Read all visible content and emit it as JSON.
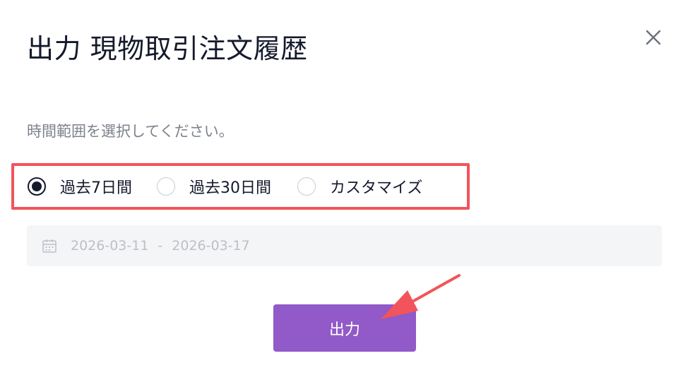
{
  "dialog": {
    "title": "出力 現物取引注文履歴",
    "close_icon": "close-icon",
    "subtitle": "時間範囲を選択してください。",
    "range_options": [
      {
        "label": "過去7日間",
        "selected": true
      },
      {
        "label": "過去30日間",
        "selected": false
      },
      {
        "label": "カスタマイズ",
        "selected": false
      }
    ],
    "date_range": {
      "icon": "calendar-icon",
      "start": "2026-03-11",
      "separator": "-",
      "end": "2026-03-17"
    },
    "export_label": "出力"
  },
  "annotation": {
    "highlight_color": "#f2545b",
    "arrow_color": "#f2545b"
  },
  "colors": {
    "accent": "#915ac8",
    "text": "#141a2b",
    "muted": "#7d828c"
  }
}
